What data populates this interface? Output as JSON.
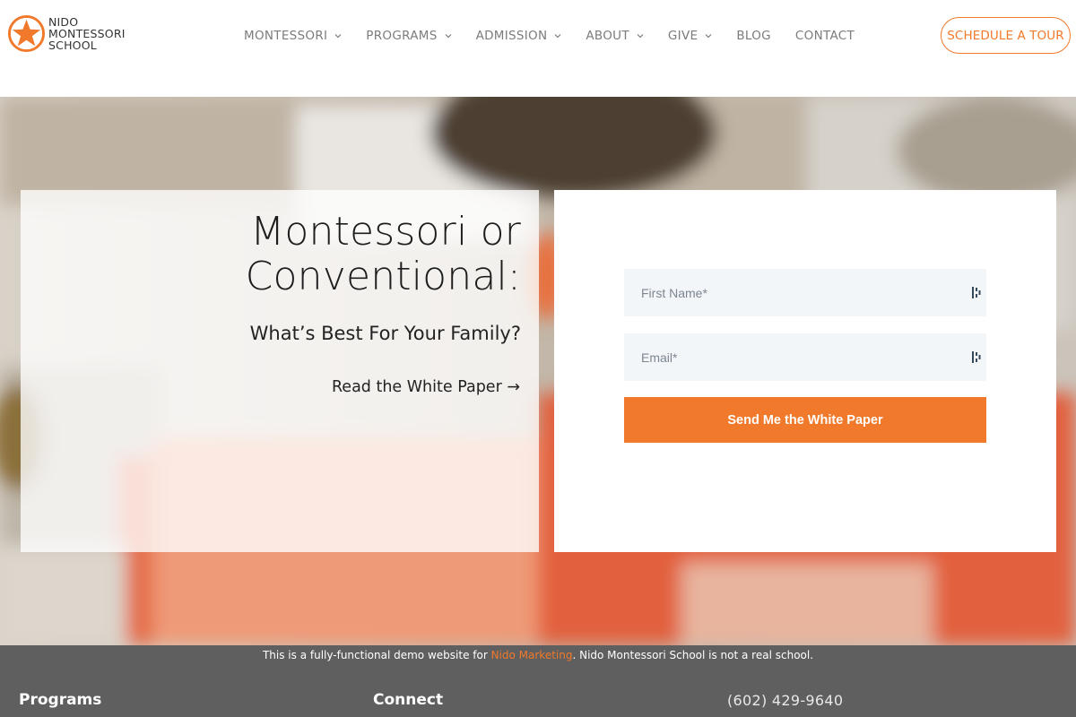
{
  "brand": {
    "line1": "NIDO",
    "line2": "MONTESSORI",
    "line3": "SCHOOL",
    "accent_color": "#f0792b",
    "logo_icon": "star-circle-icon"
  },
  "nav": {
    "items": [
      {
        "label": "MONTESSORI",
        "has_dropdown": true
      },
      {
        "label": "PROGRAMS",
        "has_dropdown": true
      },
      {
        "label": "ADMISSION",
        "has_dropdown": true
      },
      {
        "label": "ABOUT",
        "has_dropdown": true
      },
      {
        "label": "GIVE",
        "has_dropdown": true
      },
      {
        "label": "BLOG",
        "has_dropdown": false
      },
      {
        "label": "CONTACT",
        "has_dropdown": false
      }
    ],
    "cta_label": "SCHEDULE A TOUR"
  },
  "hero": {
    "headline_line1": "Montessori or",
    "headline_line2": "Conventional:",
    "subheadline": "What’s Best For Your Family?",
    "link_label": "Read the White Paper →"
  },
  "form": {
    "first_name_placeholder": "First Name*",
    "email_placeholder": "Email*",
    "submit_label": "Send Me the White Paper",
    "field_icon": "password-manager-icon"
  },
  "footer": {
    "demo_prefix": "This is a fully-functional demo website for ",
    "demo_link": "Nido Marketing",
    "demo_suffix": ". Nido Montessori School is not a real school.",
    "programs_heading": "Programs",
    "connect_heading": "Connect",
    "phone": "(602) 429-9640",
    "background_color": "#5f5f5f"
  }
}
